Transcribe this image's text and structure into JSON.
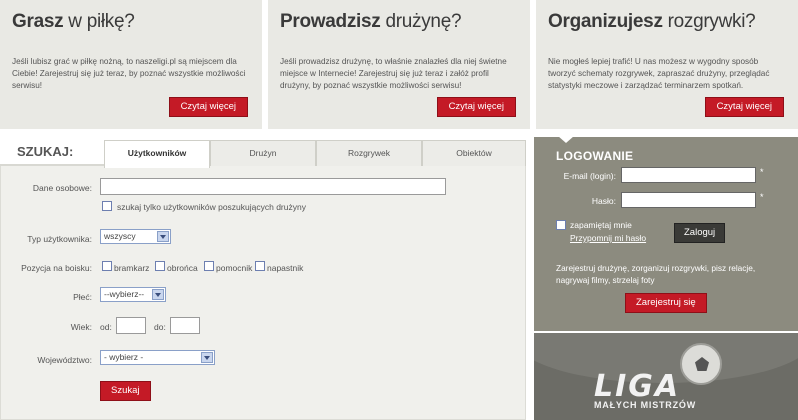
{
  "promos": [
    {
      "title_bold": "Grasz",
      "title_light": "w piłkę?",
      "description": "Jeśli lubisz grać w piłkę nożną, to naszeligi.pl są miejscem dla Ciebie! Zarejestruj się już teraz, by poznać wszystkie możliwości serwisu!",
      "button": "Czytaj więcej"
    },
    {
      "title_bold": "Prowadzisz",
      "title_light": "drużynę?",
      "description": "Jeśli prowadzisz drużynę, to właśnie znalazłeś dla niej świetne miejsce w Internecie! Zarejestruj się już teraz i załóż profil drużyny, by poznać wszystkie możliwości serwisu!",
      "button": "Czytaj więcej"
    },
    {
      "title_bold": "Organizujesz",
      "title_light": "rozgrywki?",
      "description": "Nie mogłeś lepiej trafić! U nas możesz w wygodny sposób tworzyć schematy rozgrywek, zapraszać drużyny, przeglądać statystyki meczowe i zarządzać terminarzem spotkań.",
      "button": "Czytaj więcej"
    }
  ],
  "search": {
    "label": "SZUKAJ:",
    "tabs": [
      "Użytkowników",
      "Drużyn",
      "Rozgrywek",
      "Obiektów"
    ],
    "active_tab": 0,
    "personal_label": "Dane osobowe:",
    "personal_value": "",
    "seeking_team_label": "szukaj tylko użytkowników poszukujących drużyny",
    "user_type_label": "Typ użytkownika:",
    "user_type_value": "wszyscy",
    "position_label": "Pozycja na boisku:",
    "positions": [
      "bramkarz",
      "obrońca",
      "pomocnik",
      "napastnik"
    ],
    "gender_label": "Płeć:",
    "gender_value": "--wybierz--",
    "age_label": "Wiek:",
    "age_from_label": "od:",
    "age_to_label": "do:",
    "region_label": "Województwo:",
    "region_value": "- wybierz -",
    "submit": "Szukaj"
  },
  "login": {
    "title": "LOGOWANIE",
    "email_label": "E-mail (login):",
    "password_label": "Hasło:",
    "required_mark": "*",
    "remember_label": "zapamiętaj mnie",
    "forgot_link": "Przypomnij mi hasło",
    "login_button": "Zaloguj",
    "description": "Zarejestruj drużynę, zorganizuj rozgrywki, pisz relacje, nagrywaj filmy, strzelaj foty",
    "register_button": "Zarejestruj się"
  },
  "logo": {
    "main": "LIGA",
    "sub": "MAŁYCH MISTRZÓW"
  },
  "colors": {
    "accent_red": "#c41a26",
    "panel_beige": "#e9e9e4",
    "login_bg": "#8c8b7f",
    "logo_bg": "#6c6c66"
  }
}
